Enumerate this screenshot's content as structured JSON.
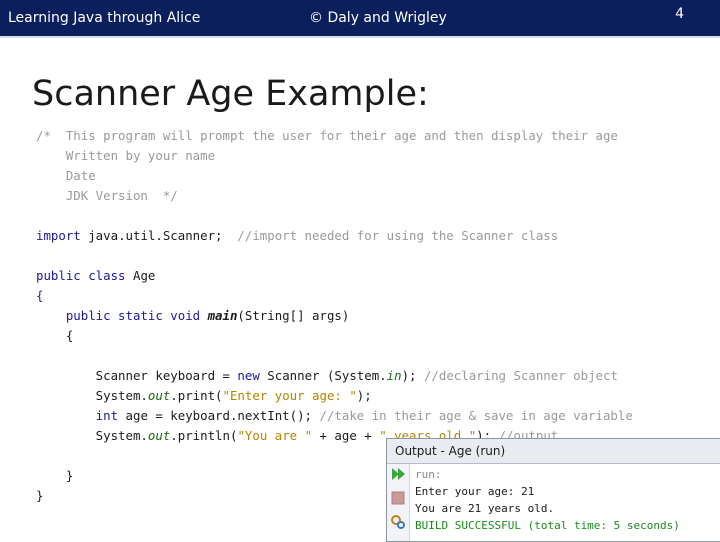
{
  "header": {
    "left_text": "Learning Java through Alice",
    "center_text": "© Daly and Wrigley",
    "page_number": "4"
  },
  "slide": {
    "title": "Scanner Age Example:"
  },
  "code": {
    "comment_lines": [
      "/*  This program will prompt the user for their age and then display their age",
      "    Written by your name",
      "    Date",
      "    JDK Version  */"
    ],
    "import_kw": "import",
    "import_stmt": " java.util.Scanner;  ",
    "import_comment": "//import needed for using the Scanner class",
    "class_kw": "public class",
    "class_name": " Age",
    "open_brace": "{",
    "main_kw": "    public static void ",
    "main_name": "main",
    "main_params": "(String[] args)",
    "method_open": "    {",
    "l1_a": "        Scanner keyboard = ",
    "l1_kw": "new",
    "l1_b": " Scanner (System.",
    "l1_field": "in",
    "l1_c": "); ",
    "l1_comment": "//declaring Scanner object",
    "l2_a": "        System.",
    "l2_field": "out",
    "l2_b": ".print(",
    "l2_str": "\"Enter your age: \"",
    "l2_c": ");",
    "l3_kw": "        int",
    "l3_a": " age = keyboard.nextInt(); ",
    "l3_comment": "//take in their age & save in age variable",
    "l4_a": "        System.",
    "l4_field": "out",
    "l4_b": ".println(",
    "l4_str1": "\"You are \"",
    "l4_c": " + age + ",
    "l4_str2": "\" years old.\"",
    "l4_d": "); ",
    "l4_comment": "//output",
    "method_close": "    }",
    "close_brace": "}"
  },
  "output_panel": {
    "title": "Output - Age (run)",
    "lines": {
      "run": "run:",
      "prompt": "Enter your age: 21",
      "result": "You are 21 years old.",
      "build": "BUILD SUCCESSFUL (total time: 5 seconds)"
    },
    "toolbar_icons": [
      "rerun-icon",
      "stop-icon",
      "settings-icon"
    ]
  },
  "colors": {
    "header_bg": "#0a1f5c",
    "keyword": "#1a1a9c",
    "string": "#b38600",
    "comment": "#9a9a9a",
    "success": "#1c8a1c"
  }
}
